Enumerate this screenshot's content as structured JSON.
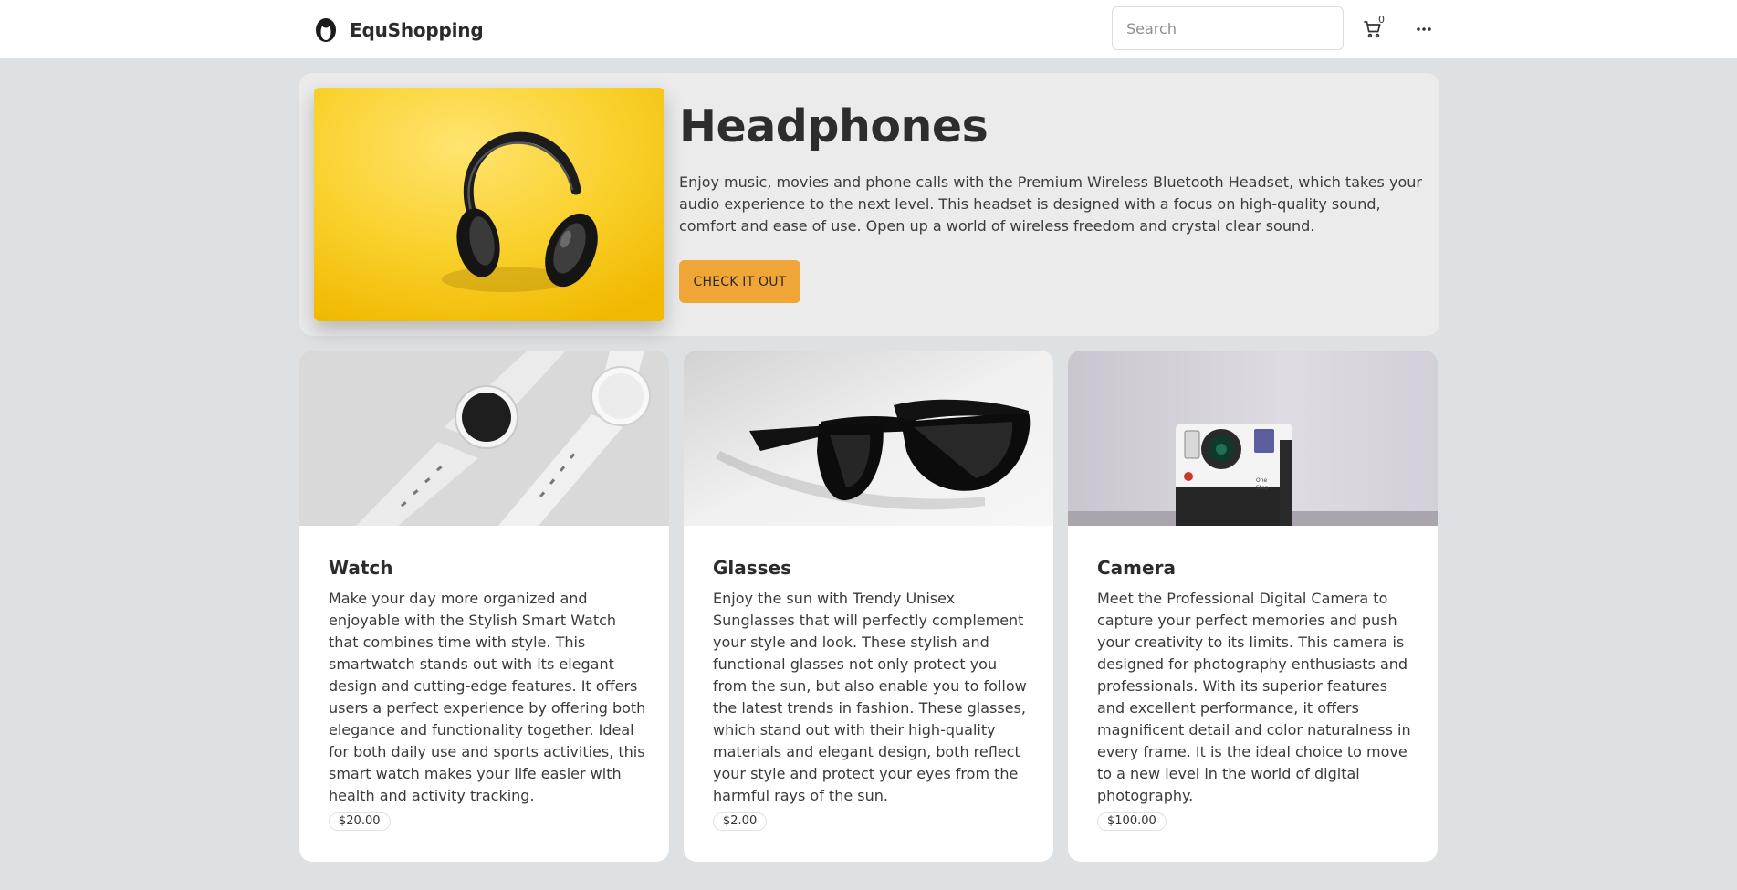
{
  "navbar": {
    "brand": "EquShopping",
    "search_placeholder": "Search",
    "cart_count": "0"
  },
  "hero": {
    "title": "Headphones",
    "description": "Enjoy music, movies and phone calls with the Premium Wireless Bluetooth Headset, which takes your audio experience to the next level. This headset is designed with a focus on high-quality sound, comfort and ease of use. Open up a world of wireless freedom and crystal clear sound.",
    "button_label": "CHECK IT OUT"
  },
  "products": [
    {
      "title": "Watch",
      "description": "Make your day more organized and enjoyable with the Stylish Smart Watch that combines time with style. This smartwatch stands out with its elegant design and cutting-edge features. It offers users a perfect experience by offering both elegance and functionality together. Ideal for both daily use and sports activities, this smart watch makes your life easier with health and activity tracking.",
      "price": "$20.00"
    },
    {
      "title": "Glasses",
      "description": "Enjoy the sun with Trendy Unisex Sunglasses that will perfectly complement your style and look. These stylish and functional glasses not only protect you from the sun, but also enable you to follow the latest trends in fashion. These glasses, which stand out with their high-quality materials and elegant design, both reflect your style and protect your eyes from the harmful rays of the sun.",
      "price": "$2.00"
    },
    {
      "title": "Camera",
      "description": "Meet the Professional Digital Camera to capture your perfect memories and push your creativity to its limits. This camera is designed for photography enthusiasts and professionals. With its superior features and excellent performance, it offers magnificent detail and color naturalness in every frame. It is the ideal choice to move to a new level in the world of digital photography.",
      "price": "$100.00"
    }
  ],
  "colors": {
    "page_bg": "#dde1e4",
    "accent_button": "#f0a637",
    "hero_bg": "#ebebeb",
    "hero_image_bg": "#f5c518"
  },
  "icons": [
    "brand-logo-icon",
    "cart-icon",
    "more-icon"
  ]
}
